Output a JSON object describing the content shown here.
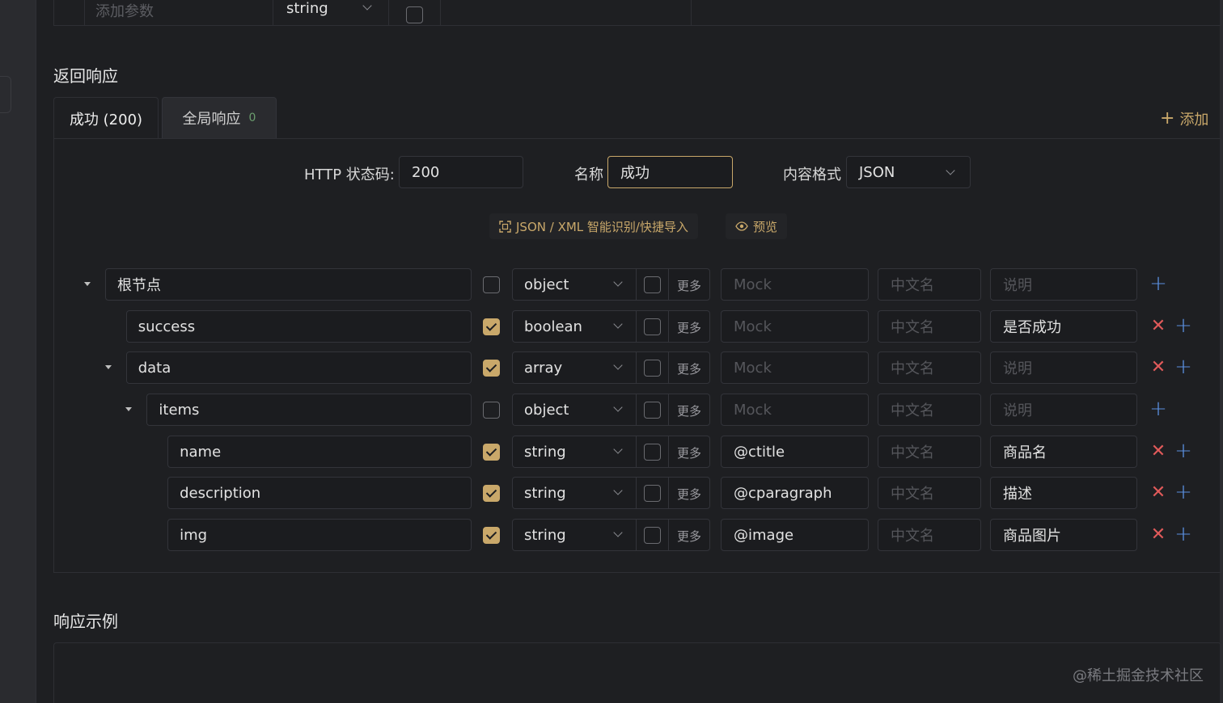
{
  "top_param_row": {
    "name_placeholder": "添加参数",
    "type_value": "string"
  },
  "response_section": {
    "title": "返回响应"
  },
  "tabs": [
    {
      "label": "成功 (200)",
      "active": true
    },
    {
      "label": "全局响应",
      "count": "0",
      "active": false
    }
  ],
  "add_label": "添加",
  "form": {
    "status_label": "HTTP 状态码:",
    "status_value": "200",
    "name_label": "名称",
    "name_value": "成功",
    "format_label": "内容格式",
    "format_value": "JSON"
  },
  "actions": {
    "import_label": "JSON / XML 智能识别/快捷导入",
    "preview_label": "预览"
  },
  "tree": {
    "more_label": "更多",
    "mock_placeholder": "Mock",
    "cn_placeholder": "中文名",
    "desc_placeholder": "说明",
    "rows": [
      {
        "name": "根节点",
        "required": false,
        "type": "object",
        "mock": "",
        "desc": ""
      },
      {
        "name": "success",
        "required": true,
        "type": "boolean",
        "mock": "",
        "desc": "是否成功"
      },
      {
        "name": "data",
        "required": true,
        "type": "array",
        "mock": "",
        "desc": ""
      },
      {
        "name": "items",
        "required": false,
        "type": "object",
        "mock": "",
        "desc": ""
      },
      {
        "name": "name",
        "required": true,
        "type": "string",
        "mock": "@ctitle",
        "desc": "商品名"
      },
      {
        "name": "description",
        "required": true,
        "type": "string",
        "mock": "@cparagraph",
        "desc": "描述"
      },
      {
        "name": "img",
        "required": true,
        "type": "string",
        "mock": "@image",
        "desc": "商品图片"
      }
    ]
  },
  "example_section": {
    "title": "响应示例"
  },
  "watermark": "@稀土掘金技术社区",
  "colors": {
    "accent": "#c9a86a",
    "delete": "#e05a5a",
    "add": "#5a8fe0",
    "background": "#1e1f22"
  }
}
